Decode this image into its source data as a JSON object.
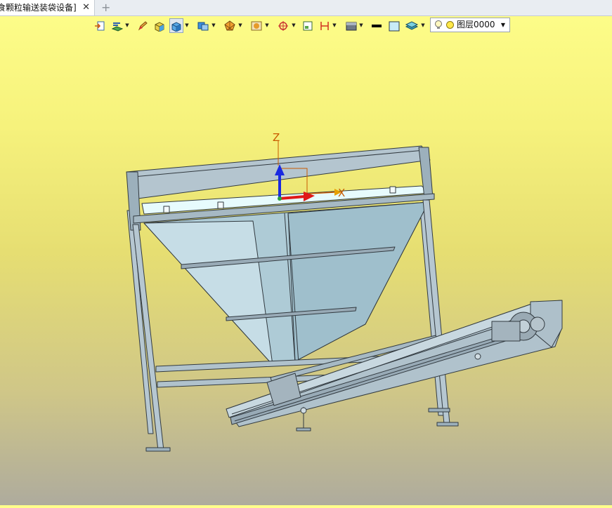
{
  "tab": {
    "title": "食颗粒输送装袋设备]",
    "close_glyph": "✕",
    "new_tab_glyph": "+"
  },
  "toolbar": {
    "buttons": [
      {
        "name": "import-icon"
      },
      {
        "name": "view-orientation-icon"
      },
      {
        "name": "pencil-icon"
      },
      {
        "name": "solid-box-icon"
      },
      {
        "name": "shaded-box-icon"
      },
      {
        "name": "display-mode-icon"
      },
      {
        "name": "polygon-icon"
      },
      {
        "name": "render-icon"
      },
      {
        "name": "snap-target-icon"
      },
      {
        "name": "small-window-icon"
      },
      {
        "name": "dimension-icon"
      },
      {
        "name": "material-icon"
      },
      {
        "name": "line-weight-icon"
      },
      {
        "name": "color-swatch-icon"
      },
      {
        "name": "layer-stack-icon"
      }
    ],
    "layer_value": "图层0000"
  },
  "scene": {
    "axis_x": "X",
    "axis_z": "Z",
    "colors": {
      "frame": "#b6c7d1",
      "hopper": "#aecbd6",
      "hopper_inner": "#e7fbfd",
      "outline": "#323a40",
      "axis_x": "#e01818",
      "axis_z": "#1a2ae0",
      "axis_label": "#c85a00"
    }
  }
}
